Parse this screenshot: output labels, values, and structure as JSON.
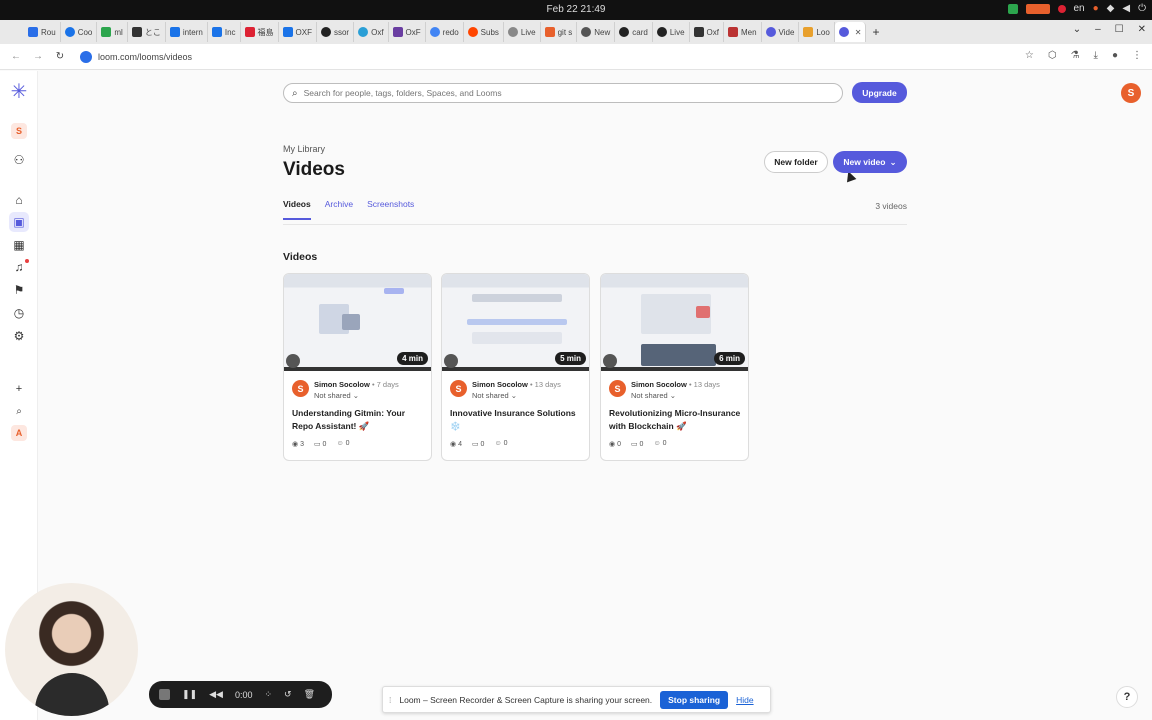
{
  "os": {
    "clock": "Feb 22  21:49",
    "lang": "en"
  },
  "browser": {
    "tabs": [
      {
        "label": "Rou"
      },
      {
        "label": "Coo"
      },
      {
        "label": "ml"
      },
      {
        "label": "とこ"
      },
      {
        "label": "intern"
      },
      {
        "label": "Inc"
      },
      {
        "label": "福島"
      },
      {
        "label": "OXF"
      },
      {
        "label": "ssor"
      },
      {
        "label": "Oxf"
      },
      {
        "label": "OxF"
      },
      {
        "label": "redo"
      },
      {
        "label": "Subs"
      },
      {
        "label": "Live"
      },
      {
        "label": "git s"
      },
      {
        "label": "New"
      },
      {
        "label": "card"
      },
      {
        "label": "Live"
      },
      {
        "label": "Oxf"
      },
      {
        "label": "Men"
      },
      {
        "label": "Vide"
      },
      {
        "label": "Loo"
      }
    ],
    "url": "loom.com/looms/videos"
  },
  "header": {
    "search_placeholder": "Search for people, tags, folders, Spaces, and Looms",
    "upgrade_label": "Upgrade",
    "avatar_initial": "S"
  },
  "sidebar": {
    "workspace_initial": "S",
    "bottom_initial": "A"
  },
  "library": {
    "breadcrumb": "My Library",
    "title": "Videos",
    "new_folder_label": "New folder",
    "new_video_label": "New video",
    "tabs": [
      {
        "label": "Videos"
      },
      {
        "label": "Archive"
      },
      {
        "label": "Screenshots"
      }
    ],
    "count_label": "3 videos",
    "section_title": "Videos"
  },
  "videos": [
    {
      "duration": "4 min",
      "author": "Simon Socolow",
      "ago": "• 7 days",
      "share": "Not shared",
      "title": "Understanding Gitmin: Your Repo Assistant! 🚀",
      "views": "3",
      "comments": "0",
      "reactions": "0",
      "avatar": "S"
    },
    {
      "duration": "5 min",
      "author": "Simon Socolow",
      "ago": "• 13 days",
      "share": "Not shared",
      "title": "Innovative Insurance Solutions ❄️",
      "views": "4",
      "comments": "0",
      "reactions": "0",
      "avatar": "S"
    },
    {
      "duration": "6 min",
      "author": "Simon Socolow",
      "ago": "• 13 days",
      "share": "Not shared",
      "title": "Revolutionizing Micro-Insurance with Blockchain 🚀",
      "views": "0",
      "comments": "0",
      "reactions": "0",
      "avatar": "S"
    }
  ],
  "recorder": {
    "time": "0:00"
  },
  "sharing": {
    "message": "Loom – Screen Recorder & Screen Capture is sharing your screen.",
    "stop_label": "Stop sharing",
    "hide_label": "Hide"
  },
  "help_label": "?"
}
